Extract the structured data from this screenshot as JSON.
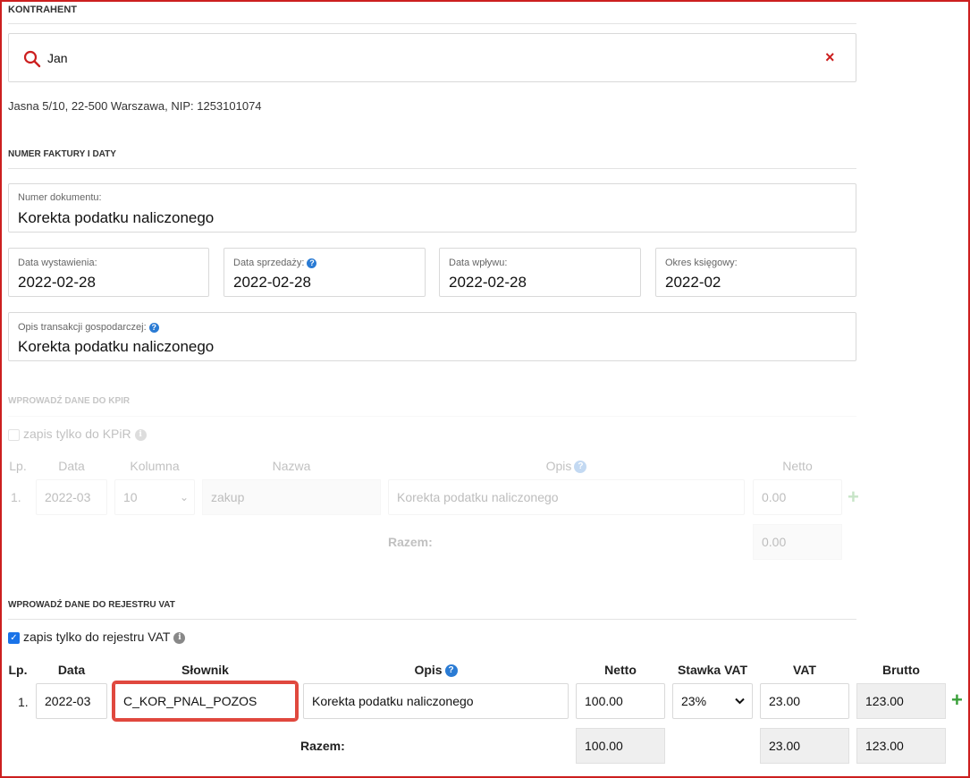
{
  "contractor": {
    "section_title": "KONTRAHENT",
    "search_value": "Jan",
    "address": "Jasna 5/10, 22-500 Warszawa, NIP: 1253101074"
  },
  "invoice": {
    "section_title": "NUMER FAKTURY I DATY",
    "doc_number_label": "Numer dokumentu:",
    "doc_number_value": "Korekta podatku naliczonego",
    "issue_date_label": "Data wystawienia:",
    "issue_date_value": "2022-02-28",
    "sale_date_label": "Data sprzedaży:",
    "sale_date_value": "2022-02-28",
    "receipt_date_label": "Data wpływu:",
    "receipt_date_value": "2022-02-28",
    "period_label": "Okres księgowy:",
    "period_value": "2022-02",
    "desc_label": "Opis transakcji gospodarczej:",
    "desc_value": "Korekta podatku naliczonego"
  },
  "kpir": {
    "section_title": "WPROWADŹ DANE DO KPIR",
    "checkbox_label": "zapis tylko do KPiR",
    "headers": {
      "lp": "Lp.",
      "date": "Data",
      "column": "Kolumna",
      "name": "Nazwa",
      "desc": "Opis",
      "net": "Netto"
    },
    "row": {
      "lp": "1.",
      "date": "2022-03",
      "column": "10",
      "name": "zakup",
      "desc": "Korekta podatku naliczonego",
      "net": "0.00"
    },
    "total_label": "Razem:",
    "total_net": "0.00"
  },
  "vat": {
    "section_title": "WPROWADŹ DANE DO REJESTRU VAT",
    "checkbox_label": "zapis tylko do rejestru VAT",
    "headers": {
      "lp": "Lp.",
      "date": "Data",
      "dict": "Słownik",
      "desc": "Opis",
      "net": "Netto",
      "rate": "Stawka VAT",
      "vat": "VAT",
      "gross": "Brutto"
    },
    "row": {
      "lp": "1.",
      "date": "2022-03",
      "dict": "C_KOR_PNAL_POZOS",
      "desc": "Korekta podatku naliczonego",
      "net": "100.00",
      "rate": "23%",
      "vat": "23.00",
      "gross": "123.00"
    },
    "total_label": "Razem:",
    "total_net": "100.00",
    "total_vat": "23.00",
    "total_gross": "123.00"
  },
  "colors": {
    "accent": "#cc1f1f",
    "help": "#2a7bd4",
    "add": "#3aa03a",
    "checkbox": "#1a73e8"
  }
}
